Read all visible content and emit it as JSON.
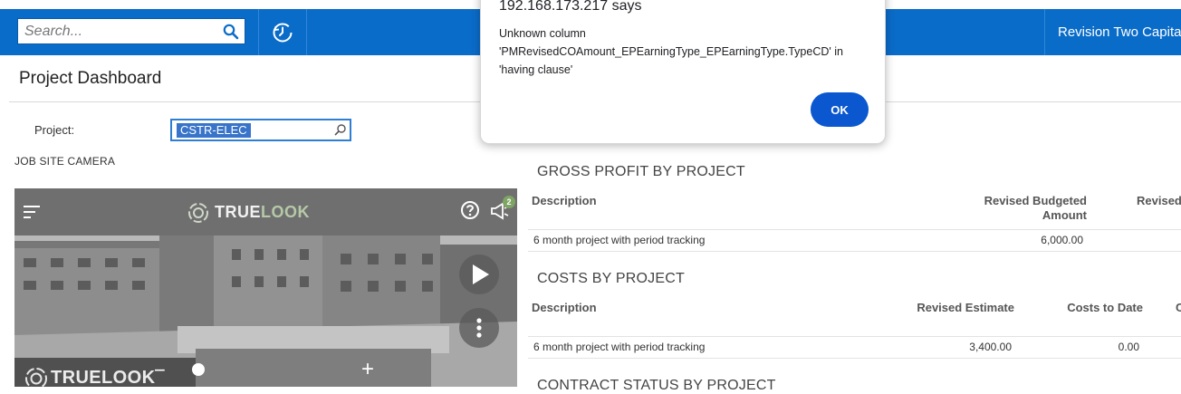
{
  "topbar": {
    "search_placeholder": "Search...",
    "company_name": "Revision Two Capital"
  },
  "page": {
    "title": "Project Dashboard",
    "project_label": "Project:",
    "project_value": "CSTR-ELEC"
  },
  "camera_widget": {
    "label": "JOB SITE CAMERA",
    "brand_prefix": "TRUE",
    "brand_suffix": "LOOK",
    "notification_count": "2",
    "watermark_prefix": "TRUELO",
    "watermark_suffix": "OK",
    "zoom_minus": "−",
    "zoom_plus": "+"
  },
  "gross_profit": {
    "title": "GROSS PROFIT BY PROJECT",
    "columns": [
      "Description",
      "Revised Budgeted Amount",
      "Revised"
    ],
    "rows": [
      {
        "description": "6 month project with period tracking",
        "revised_budgeted_amount": "6,000.00"
      }
    ]
  },
  "costs": {
    "title": "COSTS BY PROJECT",
    "columns": [
      "Description",
      "Revised Estimate",
      "Costs to Date",
      "C"
    ],
    "rows": [
      {
        "description": "6 month project with period tracking",
        "revised_estimate": "3,400.00",
        "costs_to_date": "0.00"
      }
    ]
  },
  "contract_status": {
    "title": "CONTRACT STATUS BY PROJECT"
  },
  "alert_dialog": {
    "host": "192.168.173.217 says",
    "message": "Unknown column 'PMRevisedCOAmount_EPEarningType_EPEarningType.TypeCD' in 'having clause'",
    "ok_label": "OK"
  },
  "colors": {
    "topbar": "#0a6cc9",
    "dialog_button": "#0b57d0",
    "selection": "#3874c9"
  },
  "icons": [
    "search-icon",
    "history-icon",
    "lookup-icon",
    "menu-icon",
    "help-icon",
    "megaphone-icon",
    "play-icon",
    "more-vertical-icon"
  ]
}
